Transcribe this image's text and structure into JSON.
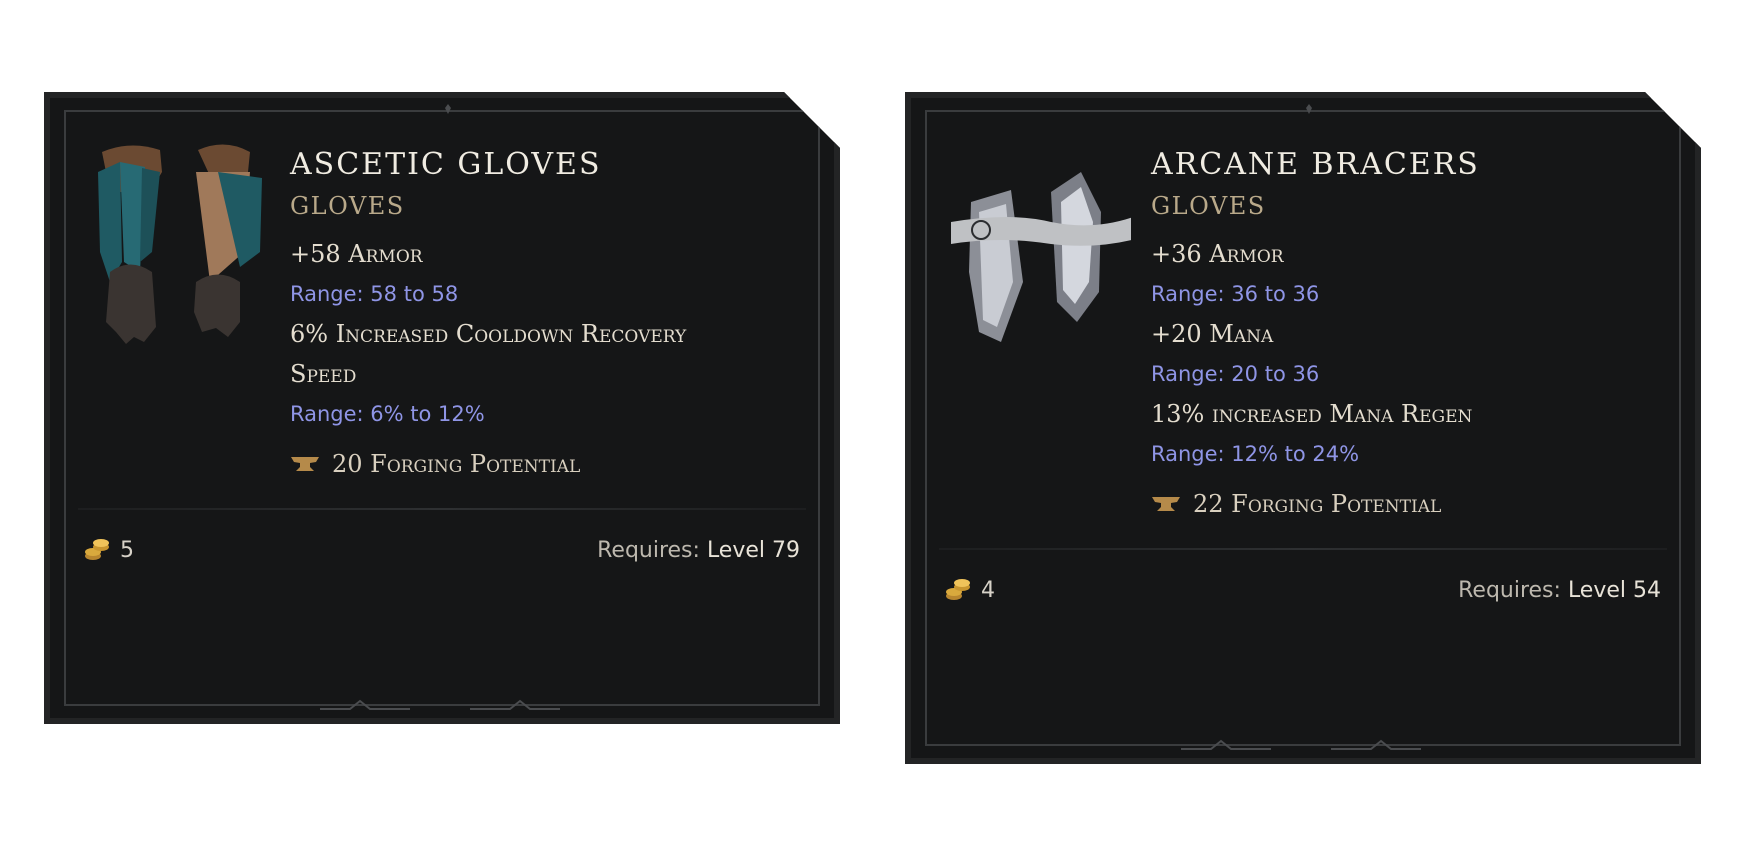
{
  "cards": [
    {
      "name": "ASCETIC GLOVES",
      "type": "GLOVES",
      "stats": [
        {
          "text": "+58 Armor",
          "range": "Range: 58 to 58"
        },
        {
          "text": "6% Increased Cooldown Recovery",
          "text2": "Speed",
          "range": "Range: 6% to 12%"
        }
      ],
      "forging": "20 Forging Potential",
      "gold": "5",
      "requires_label": "Requires:",
      "requires_value": "Level 79",
      "icon": "gloves-feathered-icon"
    },
    {
      "name": "ARCANE BRACERS",
      "type": "GLOVES",
      "stats": [
        {
          "text": "+36 Armor",
          "range": "Range: 36 to 36"
        },
        {
          "text": "+20 Mana",
          "range": "Range: 20 to 36"
        },
        {
          "text": "13% increased Mana Regen",
          "range": "Range: 12% to 24%"
        }
      ],
      "forging": "22 Forging Potential",
      "gold": "4",
      "requires_label": "Requires:",
      "requires_value": "Level 54",
      "icon": "bracers-arcane-icon"
    }
  ],
  "colors": {
    "card_bg": "#151617",
    "title": "#f0ece2",
    "type": "#b9a98a",
    "stat": "#e4ddcf",
    "range": "#8f95e6"
  }
}
